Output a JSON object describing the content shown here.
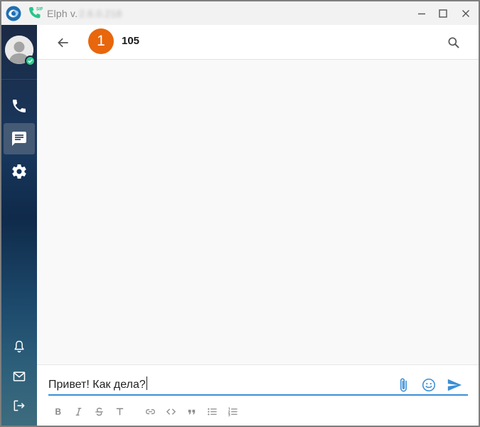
{
  "window": {
    "app_name": "Elph v.",
    "version": "2.6.0.218",
    "controls": [
      "minimize",
      "maximize",
      "close"
    ]
  },
  "sidebar": {
    "user_status": "online",
    "items": [
      {
        "name": "calls",
        "icon": "phone-icon",
        "active": false
      },
      {
        "name": "chats",
        "icon": "chat-icon",
        "active": true
      },
      {
        "name": "settings",
        "icon": "gear-icon",
        "active": false
      }
    ],
    "bottom_items": [
      {
        "name": "notifications",
        "icon": "bell-icon"
      },
      {
        "name": "mail",
        "icon": "mail-icon"
      },
      {
        "name": "logout",
        "icon": "logout-icon"
      }
    ]
  },
  "chat": {
    "contact_avatar_text": "1",
    "contact_name": "105"
  },
  "composer": {
    "message_text": "Привет! Как дела?",
    "formatting": [
      "bold",
      "italic",
      "strikethrough",
      "heading",
      "link",
      "code",
      "quote",
      "bulleted-list",
      "numbered-list"
    ]
  },
  "colors": {
    "accent": "#3a8fd6",
    "contact_avatar": "#e8660c",
    "status_online": "#2ecc8c",
    "sidebar_top": "#1b2a45",
    "sidebar_bottom": "#3e6c7e"
  }
}
